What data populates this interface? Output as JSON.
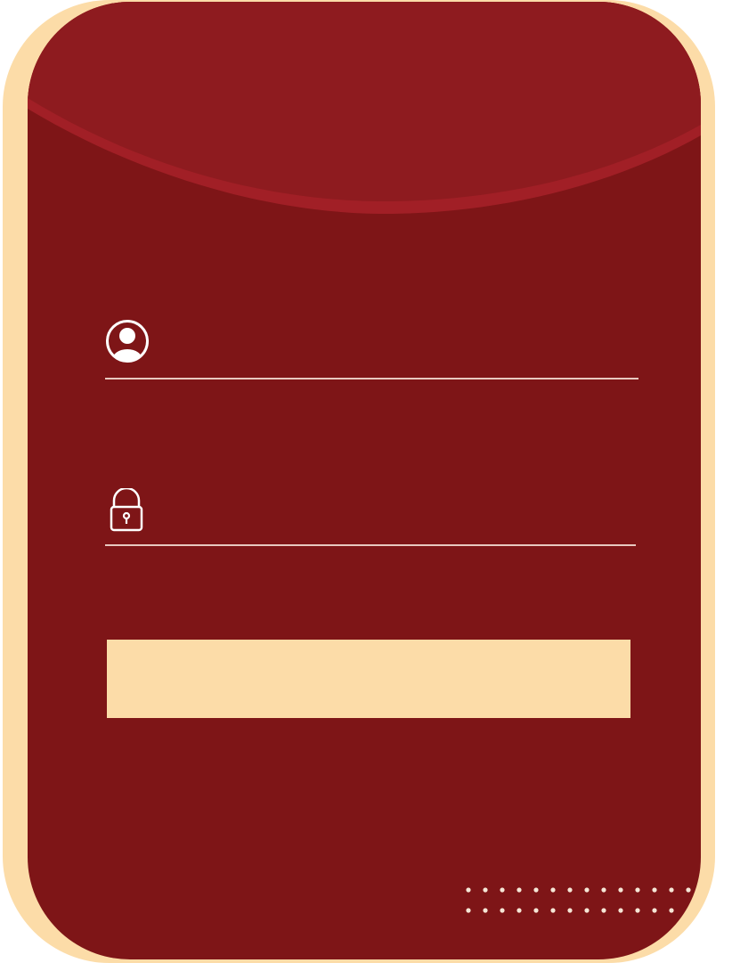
{
  "theme": {
    "card_color": "#7e1517",
    "header_color": "#8e1b1f",
    "header_stripe_color": "#a11f26",
    "accent_color": "#fcdca8",
    "line_color": "#e8c9c0"
  },
  "form": {
    "username": {
      "icon": "user-circle-icon",
      "value": "",
      "placeholder": ""
    },
    "password": {
      "icon": "lock-icon",
      "value": "",
      "placeholder": ""
    },
    "submit_label": ""
  },
  "decoration": {
    "dots_icon": "dot-grid-pattern"
  }
}
